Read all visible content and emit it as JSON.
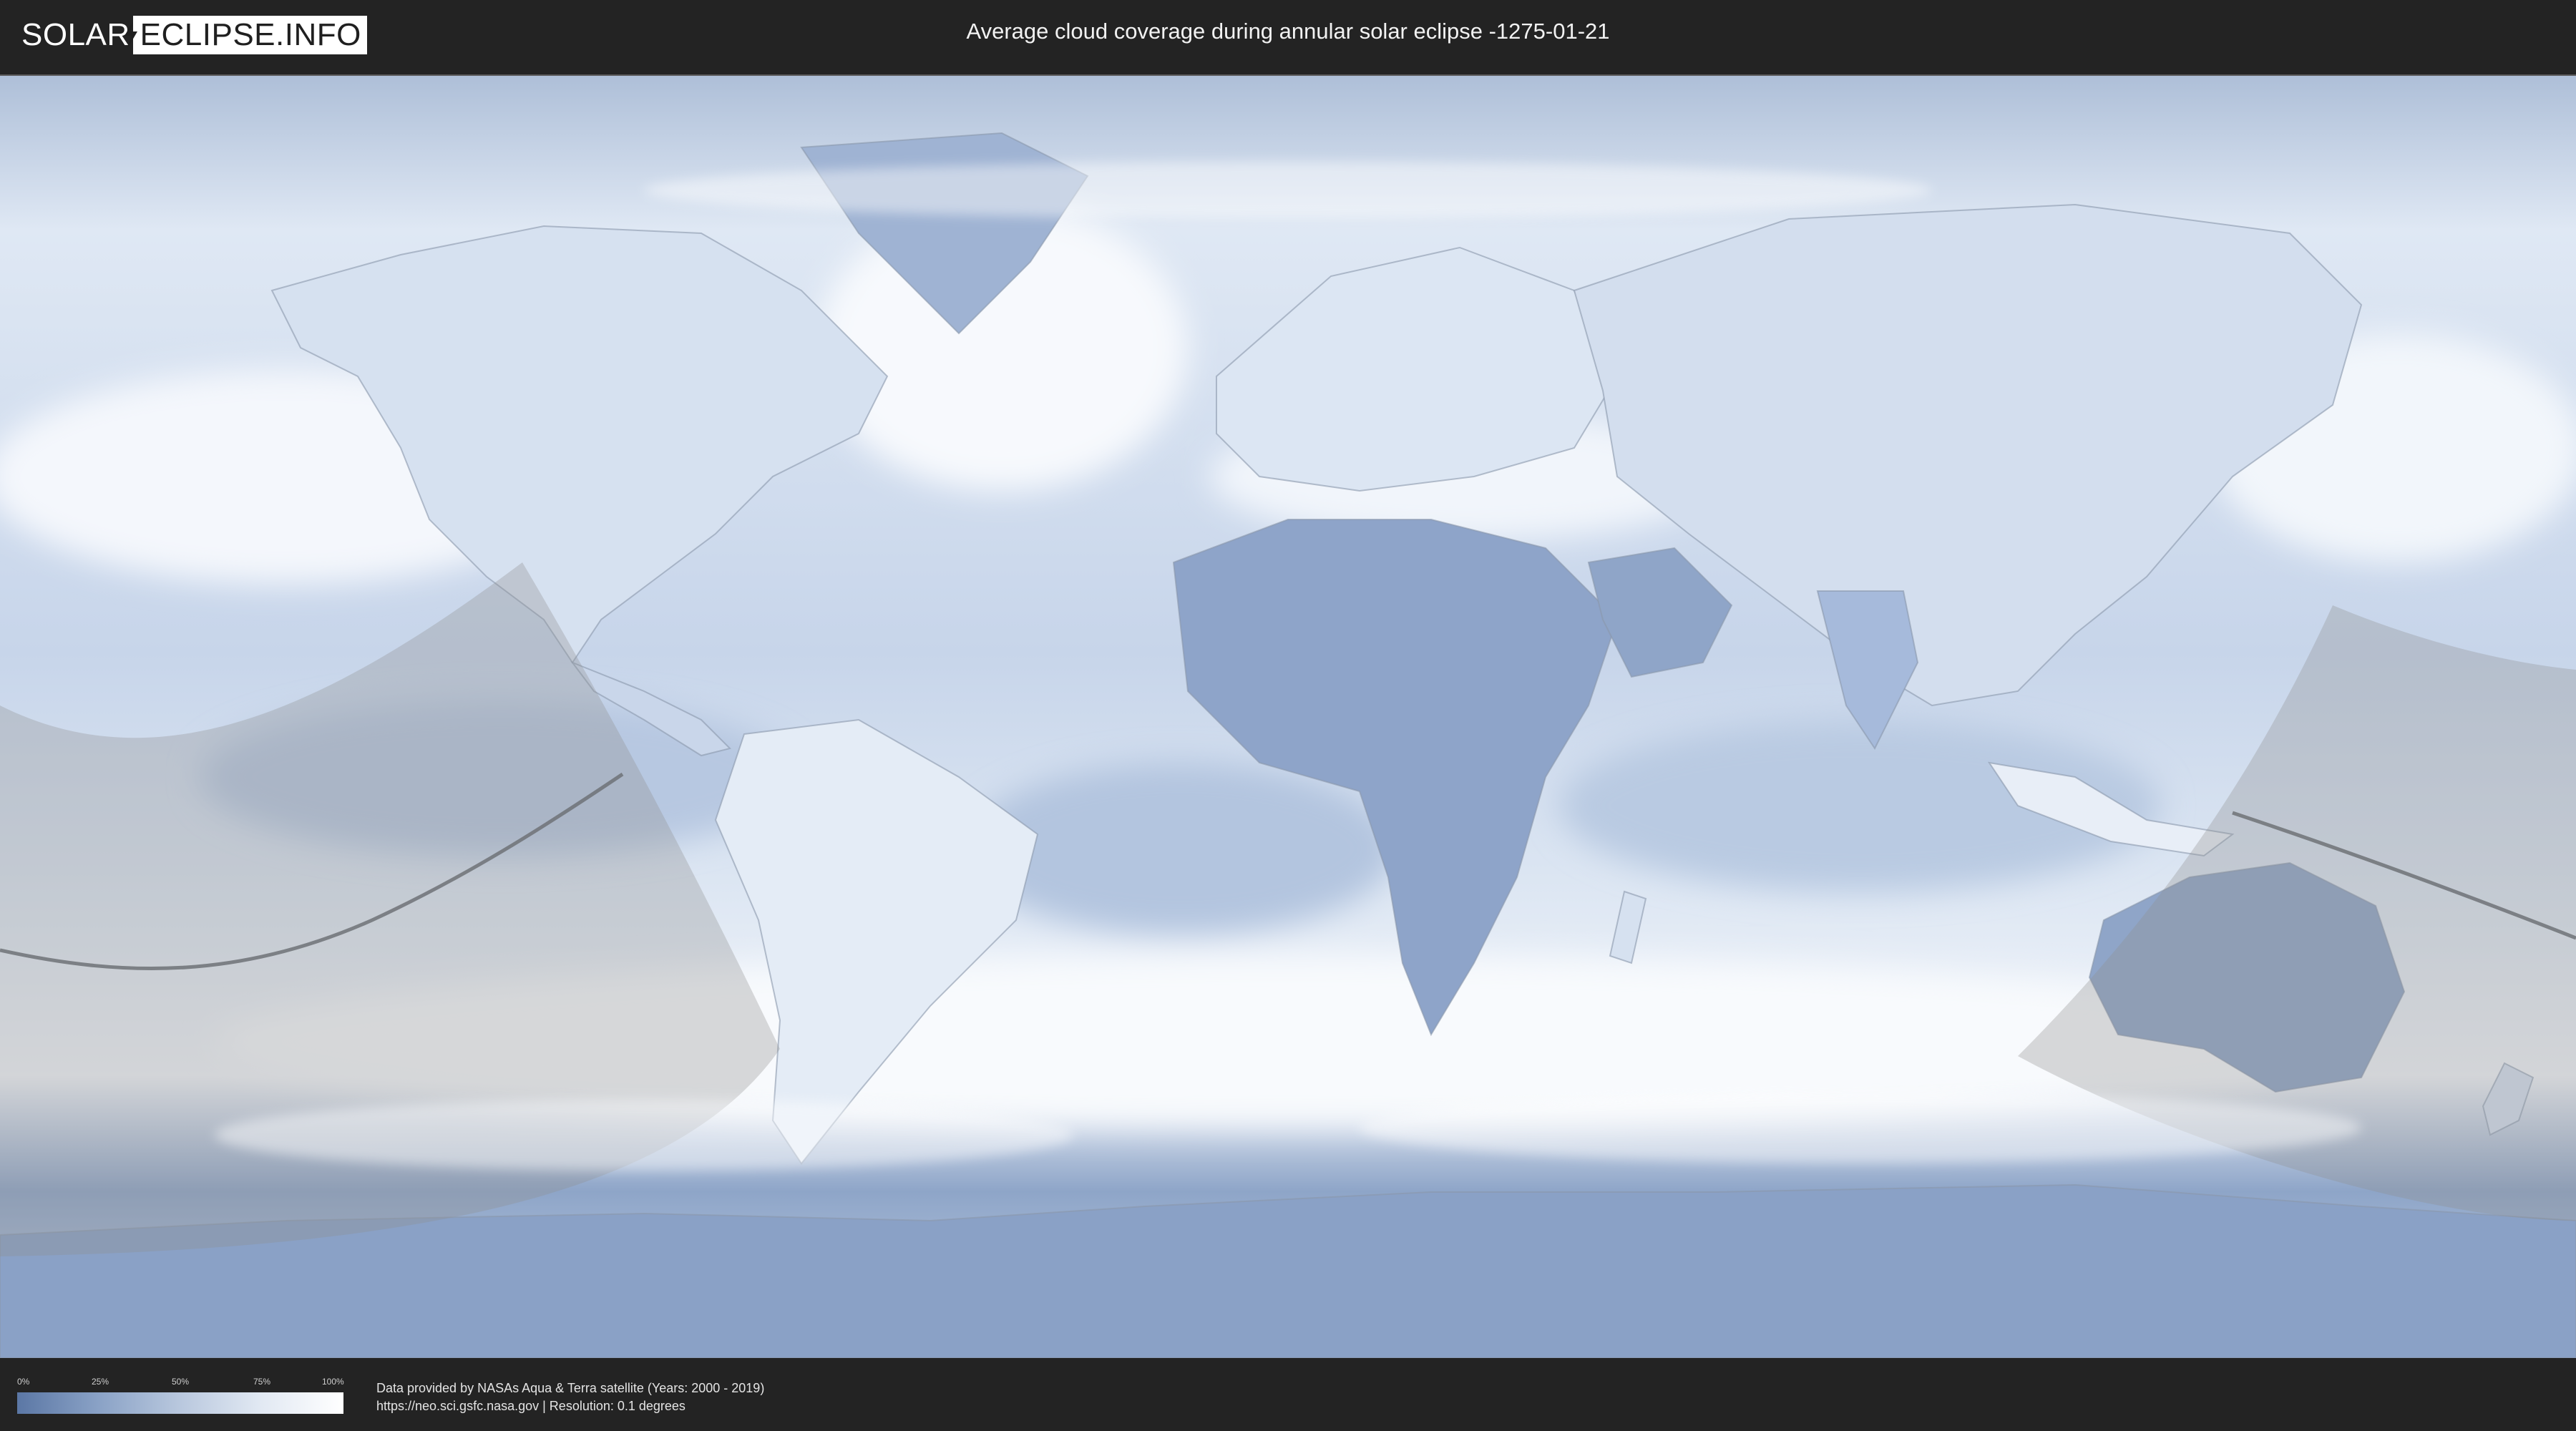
{
  "header": {
    "logo_part1": "SOLAR",
    "logo_part2": "ECLIPSE.INFO",
    "title": "Average cloud coverage during annular solar eclipse -1275-01-21"
  },
  "map": {
    "ocean_color": "#b9cbe3",
    "land_color": "#dfe8f4",
    "dark_cloud_color": "#6e89b5",
    "eclipse_overlay_color": "#9a9a9a",
    "center_line_color": "#6f7277"
  },
  "legend": {
    "ticks": [
      "0%",
      "25%",
      "50%",
      "75%",
      "100%"
    ],
    "gradient_start": "#5b77a5",
    "gradient_end": "#ffffff"
  },
  "credits": {
    "line1": "Data provided by NASAs Aqua & Terra satellite (Years: 2000 - 2019)",
    "line2": "https://neo.sci.gsfc.nasa.gov | Resolution: 0.1 degrees"
  }
}
